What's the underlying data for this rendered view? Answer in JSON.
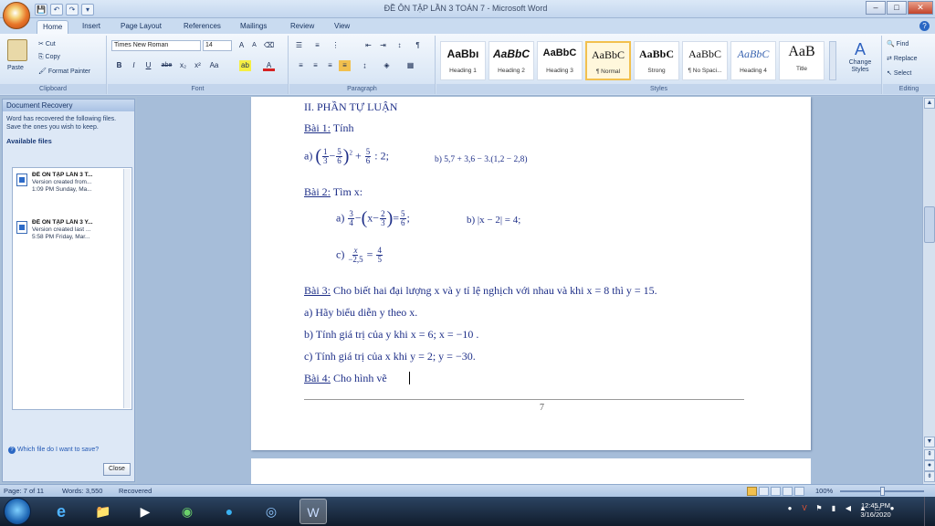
{
  "window": {
    "title": "ĐỀ ÔN TẬP LẦN 3 TOÁN 7 - Microsoft Word",
    "controls": [
      "–",
      "□",
      "✕"
    ]
  },
  "qat": [
    "💾",
    "↶",
    "↷",
    "▾"
  ],
  "tabs": [
    "Home",
    "Insert",
    "Page Layout",
    "References",
    "Mailings",
    "Review",
    "View"
  ],
  "ribbon": {
    "clipboard": {
      "paste": "Paste",
      "cut": "Cut",
      "copy": "Copy",
      "format_painter": "Format Painter",
      "label": "Clipboard"
    },
    "font": {
      "name": "Times New Roman",
      "size": "14",
      "label": "Font",
      "buttons": [
        "B",
        "I",
        "U",
        "abe",
        "x₂",
        "x²",
        "Aa"
      ]
    },
    "paragraph": {
      "label": "Paragraph"
    },
    "styles": {
      "label": "Styles",
      "items": [
        {
          "sample": "AaBbı",
          "name": "Heading 1"
        },
        {
          "sample": "AaBbC",
          "name": "Heading 2"
        },
        {
          "sample": "AaBbC",
          "name": "Heading 3"
        },
        {
          "sample": "AaBbC",
          "name": "¶ Normal"
        },
        {
          "sample": "AaBbC",
          "name": "Strong"
        },
        {
          "sample": "AaBbC",
          "name": "¶ No Spaci..."
        },
        {
          "sample": "AaBbC",
          "name": "Heading 4"
        },
        {
          "sample": "AaB",
          "name": "Title"
        }
      ],
      "change_styles": "Change Styles"
    },
    "editing": {
      "find": "Find",
      "replace": "Replace",
      "select": "Select",
      "label": "Editing"
    }
  },
  "recovery": {
    "header": "Document Recovery",
    "message": "Word has recovered the following files. Save the ones you wish to keep.",
    "available": "Available files",
    "files": [
      {
        "name": "ĐỀ ÔN TẬP LẦN 3 T...",
        "line2": "Version created from...",
        "line3": "1:09 PM Sunday, Ma..."
      },
      {
        "name": "ĐỀ ÔN TẬP LẦN 3 Y...",
        "line2": "Version created last ...",
        "line3": "5:58 PM Friday, Mar..."
      }
    ],
    "which_file": "Which file do I want to save?",
    "close": "Close"
  },
  "document": {
    "section": "II. PHẦN TỰ LUẬN",
    "b1_label": "Bài 1:",
    "b1_title": "Tính",
    "b1_b": "b) 5,7 + 3,6 − 3.(1,2 − 2,8)",
    "b2_label": "Bài 2:",
    "b2_title": "Tìm x:",
    "b2_b": "b) |x − 2| = 4;",
    "b3_label": "Bài 3:",
    "b3_text": "Cho biết hai đại lượng x và y tỉ lệ nghịch với nhau và khi x = 8 thì y = 15.",
    "b3_a": "a) Hãy biểu diễn y theo x.",
    "b3_b": "b) Tính giá trị của y khi x = 6; x = −10 .",
    "b3_c": "c) Tính giá trị của x khi y = 2; y = −30.",
    "b4_label": "Bài 4:",
    "b4_text": "Cho hình vẽ",
    "page_number": "7"
  },
  "status": {
    "page": "Page: 7 of 11",
    "words": "Words: 3,550",
    "recovered": "Recovered",
    "zoom": "100%"
  },
  "taskbar": {
    "clock_time": "12:45 PM",
    "clock_date": "3/16/2020"
  }
}
